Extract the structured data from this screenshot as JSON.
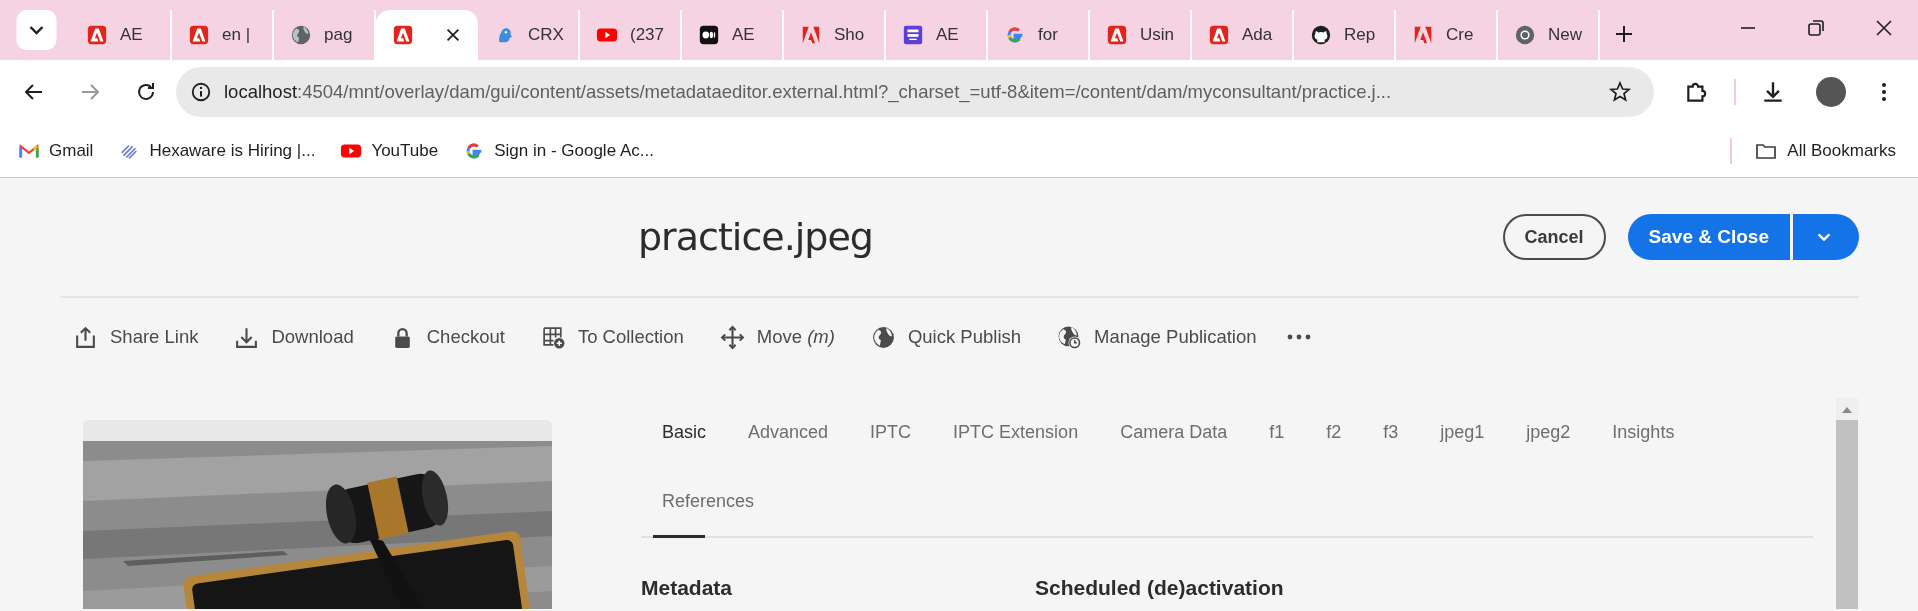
{
  "browser": {
    "tabs": [
      {
        "title": "AE",
        "kind": "adobe",
        "selected": false
      },
      {
        "title": "en |",
        "kind": "adobe",
        "selected": false
      },
      {
        "title": "pag",
        "kind": "globe",
        "selected": false
      },
      {
        "kind": "adobe",
        "selected": true
      },
      {
        "title": "CRX",
        "kind": "crx",
        "selected": false
      },
      {
        "title": "(237",
        "kind": "youtube",
        "selected": false
      },
      {
        "title": "AE",
        "kind": "medium",
        "selected": false
      },
      {
        "title": "Sho",
        "kind": "adobe-plain",
        "selected": false
      },
      {
        "title": "AE",
        "kind": "sg",
        "selected": false
      },
      {
        "title": "for",
        "kind": "google",
        "selected": false
      },
      {
        "title": "Usin",
        "kind": "adobe",
        "selected": false
      },
      {
        "title": "Ada",
        "kind": "adobe",
        "selected": false
      },
      {
        "title": "Rep",
        "kind": "github",
        "selected": false
      },
      {
        "title": "Cre",
        "kind": "adobe-plain",
        "selected": false
      },
      {
        "title": "New",
        "kind": "chrome",
        "selected": false
      }
    ],
    "nav": [
      {
        "kind": "back",
        "disabled": false
      },
      {
        "kind": "forward",
        "disabled": true
      },
      {
        "kind": "reload",
        "disabled": false
      }
    ],
    "address": {
      "host": "localhost",
      "path": ":4504/mnt/overlay/dam/gui/content/assets/metadataeditor.external.html?_charset_=utf-8&item=/content/dam/myconsultant/practice.j..."
    },
    "bookmarks": [
      {
        "label": "Gmail",
        "kind": "gmail"
      },
      {
        "label": "Hexaware is Hiring |...",
        "kind": "hexaware"
      },
      {
        "label": "YouTube",
        "kind": "youtube"
      },
      {
        "label": "Sign in - Google Ac...",
        "kind": "google"
      }
    ],
    "all_bookmarks": "All Bookmarks"
  },
  "page": {
    "title": "practice.jpeg",
    "cancel": "Cancel",
    "save": "Save & Close",
    "actions": [
      {
        "label": "Share Link",
        "kind": "share"
      },
      {
        "label": "Download",
        "kind": "download"
      },
      {
        "label": "Checkout",
        "kind": "lock"
      },
      {
        "label": "To Collection",
        "kind": "collection"
      },
      {
        "label": "Move *(m)*",
        "kind": "move"
      },
      {
        "label": "Quick Publish",
        "kind": "globe"
      },
      {
        "label": "Manage Publication",
        "kind": "globe-clock"
      }
    ],
    "preview": {
      "kind": "picture"
    },
    "tabs": [
      {
        "label": "Basic",
        "selected": true
      },
      {
        "label": "Advanced",
        "selected": false
      },
      {
        "label": "IPTC",
        "selected": false
      },
      {
        "label": "IPTC Extension",
        "selected": false
      },
      {
        "label": "Camera Data",
        "selected": false
      },
      {
        "label": "f1",
        "selected": false
      },
      {
        "label": "f2",
        "selected": false
      },
      {
        "label": "f3",
        "selected": false
      },
      {
        "label": "jpeg1",
        "selected": false
      },
      {
        "label": "jpeg2",
        "selected": false
      },
      {
        "label": "Insights",
        "selected": false
      },
      {
        "label": "References",
        "selected": false
      }
    ],
    "sections": [
      "Metadata",
      "Scheduled (de)activation"
    ]
  }
}
